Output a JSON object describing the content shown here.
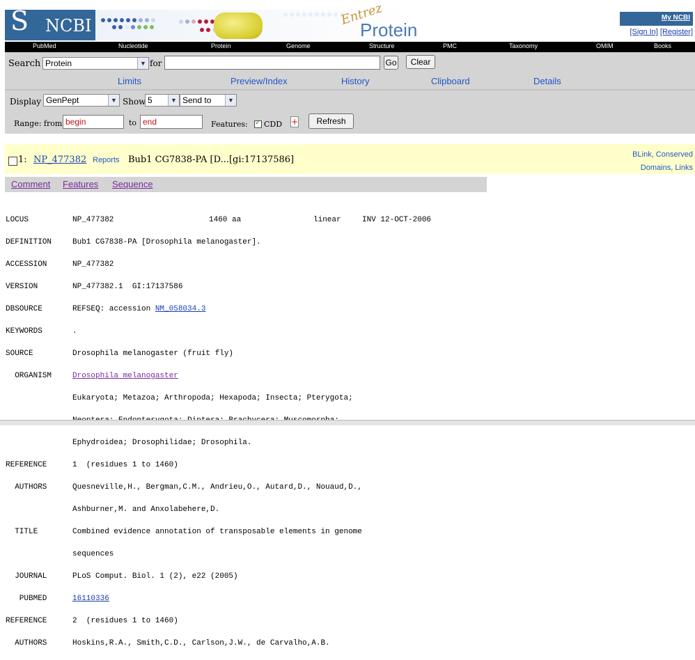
{
  "brand": {
    "logo_symbol": "S",
    "logo_text": "NCBI",
    "entrez": "Entrez",
    "db_title": "Protein"
  },
  "account": {
    "my_ncbi": "My NCBI",
    "sign_in": "[Sign In]",
    "register": "[Register]"
  },
  "navbar": [
    "PubMed",
    "Nucleotide",
    "Protein",
    "Genome",
    "Structure",
    "PMC",
    "Taxonomy",
    "OMIM",
    "Books"
  ],
  "search": {
    "label": "Search",
    "database": "Protein",
    "for_label": "for",
    "query": "",
    "go": "Go",
    "clear": "Clear"
  },
  "tabs": [
    "Limits",
    "Preview/Index",
    "History",
    "Clipboard",
    "Details"
  ],
  "display": {
    "label": "Display",
    "format": "GenPept",
    "show_label": "Show",
    "show_value": "5",
    "send_to": "Send to"
  },
  "range": {
    "label": "Range: from",
    "begin": "begin",
    "to_label": "to",
    "end": "end",
    "features_label": "Features:",
    "cdd": "CDD",
    "cdd_checked": true,
    "plus": "+",
    "refresh": "Refresh"
  },
  "result": {
    "number": "1:",
    "accession": "NP_477382",
    "reports": "Reports",
    "title": "Bub1 CG7838-PA [D...[gi:17137586]",
    "side_links": [
      "BLink, Conserved",
      "Domains, Links"
    ]
  },
  "subtabs": [
    "Comment",
    "Features",
    "Sequence"
  ],
  "record": {
    "locus": {
      "key": "LOCUS",
      "name": "NP_477382",
      "length": "1460 aa",
      "topology": "linear",
      "division": "INV 12-OCT-2006"
    },
    "definition": {
      "key": "DEFINITION",
      "value": "Bub1 CG7838-PA [Drosophila melanogaster]."
    },
    "accession": {
      "key": "ACCESSION",
      "value": "NP_477382"
    },
    "version": {
      "key": "VERSION",
      "value": "NP_477382.1  GI:17137586"
    },
    "dbsource": {
      "key": "DBSOURCE",
      "prefix": "REFSEQ: accession ",
      "link": "NM_058034.3"
    },
    "keywords": {
      "key": "KEYWORDS",
      "value": "."
    },
    "source": {
      "key": "SOURCE",
      "value": "Drosophila melanogaster (fruit fly)"
    },
    "organism": {
      "key": "  ORGANISM",
      "link": "Drosophila melanogaster",
      "lines": [
        "Eukaryota; Metazoa; Arthropoda; Hexapoda; Insecta; Pterygota;",
        "Neoptera; Endopterygota; Diptera; Brachycera; Muscomorpha;",
        "Ephydroidea; Drosophilidae; Drosophila."
      ]
    },
    "ref1": {
      "key": "REFERENCE",
      "value": "1  (residues 1 to 1460)",
      "authors_key": "  AUTHORS",
      "authors": [
        "Quesneville,H., Bergman,C.M., Andrieu,O., Autard,D., Nouaud,D.,",
        "Ashburner,M. and Anxolabehere,D."
      ],
      "title_key": "  TITLE",
      "title": [
        "Combined evidence annotation of transposable elements in genome",
        "sequences"
      ],
      "journal_key": "  JOURNAL",
      "journal": "PLoS Comput. Biol. 1 (2), e22 (2005)",
      "pubmed_key": "   PUBMED",
      "pubmed": "16110336"
    },
    "ref2": {
      "key": "REFERENCE",
      "value": "2  (residues 1 to 1460)",
      "authors_key": "  AUTHORS",
      "authors_partial": "Hoskins,R.A., Smith,C.D., Carlson,J.W., de Carvalho,A.B."
    }
  },
  "colors": {
    "ncbi_blue": "#336699",
    "panel_gray": "#d4d4d4",
    "result_yellow": "#ffffcc",
    "link_blue": "#1a3fb0",
    "visited_purple": "#7a2aa0"
  }
}
